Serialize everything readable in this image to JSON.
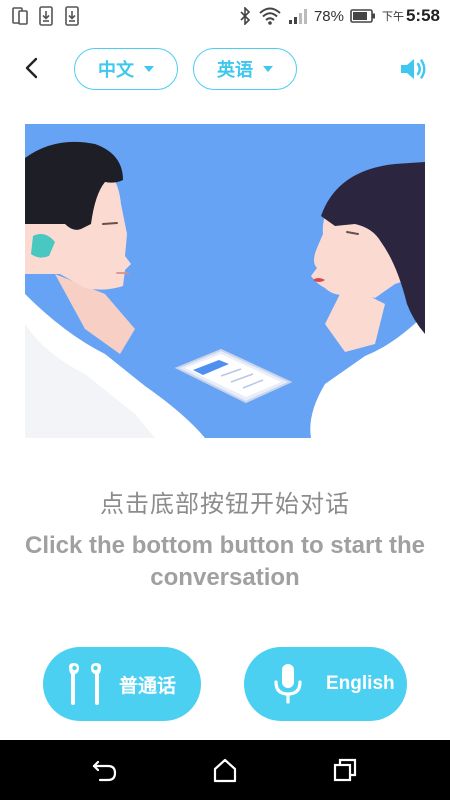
{
  "status_bar": {
    "battery_percent": "78%",
    "ampm": "下午",
    "time": "5:58",
    "icons": [
      "phone-tablet-icon",
      "download-icon",
      "download-icon",
      "bluetooth-icon",
      "wifi-icon",
      "signal-icon",
      "battery-icon"
    ]
  },
  "header": {
    "source_language": "中文",
    "target_language": "英语",
    "icons": [
      "back-chevron-icon",
      "caret-down-icon",
      "speaker-icon"
    ]
  },
  "instructions": {
    "chinese": "点击底部按钮开始对话",
    "english": "Click the bottom button to start the conversation"
  },
  "buttons": {
    "mandarin": {
      "label": "普通话",
      "icon": "earbuds-icon"
    },
    "english": {
      "label": "English",
      "icon": "microphone-icon"
    }
  },
  "nav_bar": {
    "icons": [
      "back-icon",
      "home-icon",
      "recents-icon"
    ]
  },
  "colors": {
    "accent": "#4cd0f2",
    "illustration_bg": "#66a3f5",
    "text_gray": "#8c8c8c"
  }
}
